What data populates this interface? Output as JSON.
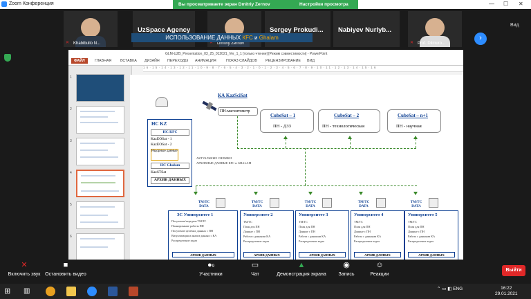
{
  "window": {
    "app_title": "Zoom Конференция",
    "banner_text": "Вы просматриваете экран Dmitriy Zernov",
    "banner_options": "Настройки просмотра"
  },
  "participants": [
    {
      "name": "Khabibullo N..."
    },
    {
      "name": "UzSpace Agency"
    },
    {
      "name": "Dmitriy Zernov"
    },
    {
      "name": "Sergey Prokudi..."
    },
    {
      "name": "Nabiyev Nurlyb..."
    },
    {
      "name": "Prof. Dilmuro..."
    }
  ],
  "view_label": "Вид",
  "ppt": {
    "title": "GLM-UZB_Presentation_03_25_012021_Ver_1_1 [только чтение] [Режим совместимости] - PowerPoint",
    "tabs": [
      "ФАЙЛ",
      "ГЛАВНАЯ",
      "ВСТАВКА",
      "ДИЗАЙН",
      "ПЕРЕХОДЫ",
      "АНИМАЦИЯ",
      "ПОКАЗ СЛАЙДОВ",
      "РЕЦЕНЗИРОВАНИЕ",
      "ВИД"
    ],
    "ruler": "16·15·14·13·12·11·10·9·8·7·6·5·4·3·2·1·0·1·2·3·4·5·6·7·8·9·10·11·12·13·14·15·16",
    "thumb_numbers": [
      "1",
      "2",
      "3",
      "4",
      "5",
      "6"
    ],
    "active_slide": 4
  },
  "slide": {
    "heading_pre": "ИСПОЛЬЗОВАНИЕ ДАННЫХ ",
    "heading_kfs": "КFС",
    "heading_and": " и ",
    "heading_galam": "Ghalam",
    "satellite": {
      "name": "КА KazSciSat",
      "payload": "ПН-магнитометр"
    },
    "hc_kz": {
      "title": "НС KZ",
      "sub": "НС КFС",
      "sat1": "KazEOSat - 1",
      "sat2": "KazEOSat - 2",
      "raw": "Рядорные данные",
      "galam": "НС Ghalam",
      "kazst": "KazSTSat",
      "archive": "АРХИВ ДАННЫХ"
    },
    "cubesats": [
      {
        "name": "CubeSat – 1",
        "payload": "ПН - ДЗЗ"
      },
      {
        "name": "CubeSat – 2",
        "payload": "ПН - технологическая"
      },
      {
        "name": "CubeSat – n+1",
        "payload": "ПН - научная"
      }
    ],
    "note1": "АКТУАЛЬНЫЕ СНИМКИ",
    "note2": "АРХИВНЫЕ ДАННЫЕ КFС и GHALAM",
    "tmtc": "TM/TC DATA",
    "main_uni": {
      "title": "ЗС Университет 1",
      "lines": [
        "Получение/передача TM/TC",
        "Планирование работы ПН",
        "Получение целевых данных с ПН",
        "Визуализация и анализ данных с КА",
        "Распределение задач"
      ],
      "archive": "АРХИВ ДАННЫХ"
    },
    "unis": [
      {
        "title": "Университет 2",
        "lines": [
          "TM/TC",
          "План для ПН",
          "Данные с ПН",
          "Работа с данными КА",
          "Распределение задач"
        ],
        "archive": "АРХИВ ДАННЫХ"
      },
      {
        "title": "Университет 3",
        "lines": [
          "TM/TC",
          "План для ПН",
          "Данные с ПН",
          "Работа с данными КА",
          "Распределение задач"
        ],
        "archive": "АРХИВ ДАННЫХ"
      },
      {
        "title": "Университет 4",
        "lines": [
          "TM/TC",
          "План для ПН",
          "Данные с ПН",
          "Работа с данными КА",
          "Распределение задач"
        ],
        "archive": "АРХИВ ДАННЫХ"
      },
      {
        "title": "Университет 5",
        "lines": [
          "TM/TC",
          "План для ПН",
          "Данные с ПН",
          "Работа с данными КА",
          "Распределение задач"
        ],
        "archive": "АРХИВ ДАННЫХ"
      }
    ]
  },
  "controls": {
    "audio": "Включить звук",
    "video": "Остановить видео",
    "participants": "Участники",
    "participants_count": "9",
    "chat": "Чат",
    "share": "Демонстрация экрана",
    "record": "Запись",
    "reactions": "Реакции",
    "exit": "Выйти"
  },
  "taskbar": {
    "lang": "ENG",
    "time": "16:22",
    "date": "29.01.2021"
  }
}
